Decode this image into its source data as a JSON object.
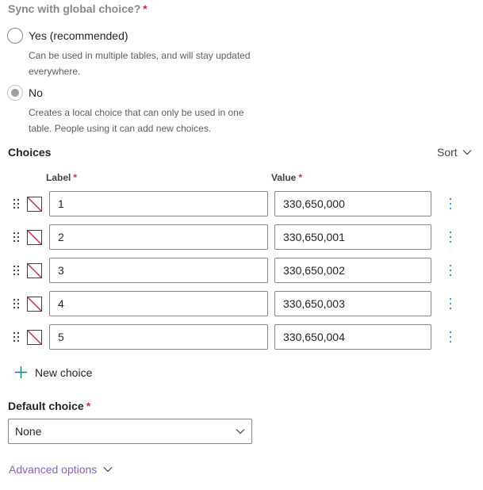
{
  "sync": {
    "question": "Sync with global choice?",
    "required_mark": "*",
    "options": [
      {
        "label": "Yes (recommended)",
        "description": "Can be used in multiple tables, and will stay updated everywhere.",
        "selected": false
      },
      {
        "label": "No",
        "description": "Creates a local choice that can only be used in one table. People using it can add new choices.",
        "selected": true
      }
    ]
  },
  "choices": {
    "title": "Choices",
    "sort_label": "Sort",
    "label_header": "Label",
    "value_header": "Value",
    "required_mark": "*",
    "rows": [
      {
        "label": "1",
        "value": "330,650,000"
      },
      {
        "label": "2",
        "value": "330,650,001"
      },
      {
        "label": "3",
        "value": "330,650,002"
      },
      {
        "label": "4",
        "value": "330,650,003"
      },
      {
        "label": "5",
        "value": "330,650,004"
      }
    ],
    "new_choice_label": "New choice"
  },
  "default_choice": {
    "label": "Default choice",
    "required_mark": "*",
    "value": "None"
  },
  "advanced_options_label": "Advanced options",
  "colors": {
    "accent": "#0078d4",
    "link": "#8764b8",
    "required": "#c4314b",
    "add_icon": "#038387"
  }
}
